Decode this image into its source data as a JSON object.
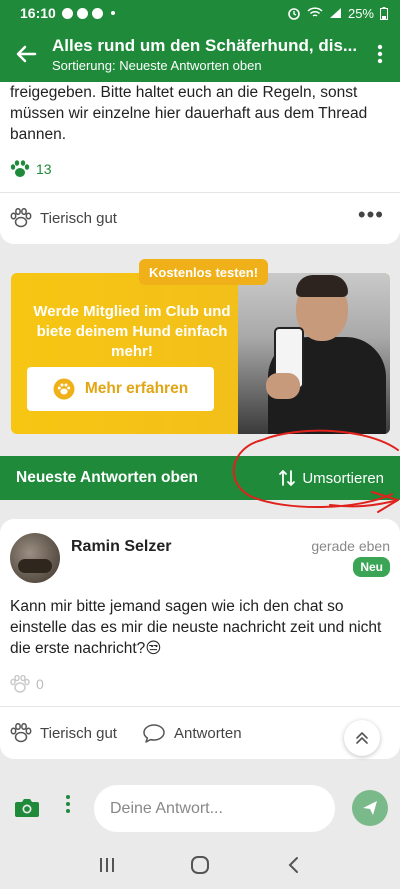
{
  "statusbar": {
    "time": "16:10",
    "battery": "25%"
  },
  "appbar": {
    "title": "Alles rund um den Schäferhund, dis...",
    "subtitle": "Sortierung: Neueste Antworten oben"
  },
  "previous_post": {
    "text": "freigegeben. Bitte haltet euch an die Regeln, sonst müssen wir einzelne hier dauerhaft aus dem Thread bannen.",
    "likes": "13",
    "reaction_label": "Tierisch gut"
  },
  "ad": {
    "badge": "Kostenlos testen!",
    "headline": "Werde Mitglied im Club und biete deinem Hund einfach mehr!",
    "cta": "Mehr erfahren"
  },
  "sortbar": {
    "title": "Neueste Antworten oben",
    "resort_label": "Umsortieren"
  },
  "post": {
    "author": "Ramin Selzer",
    "time": "gerade eben",
    "badge": "Neu",
    "text": "Kann mir bitte jemand sagen wie ich den chat so einstelle das es mir die neuste nachricht zeit und nicht die erste nachricht?😒",
    "likes": "0",
    "reaction_label": "Tierisch gut",
    "reply_label": "Antworten"
  },
  "composer": {
    "placeholder": "Deine Antwort..."
  },
  "colors": {
    "brand_green": "#1e8a3a",
    "ad_yellow": "#f7c613",
    "annotation_red": "#e0221d"
  }
}
